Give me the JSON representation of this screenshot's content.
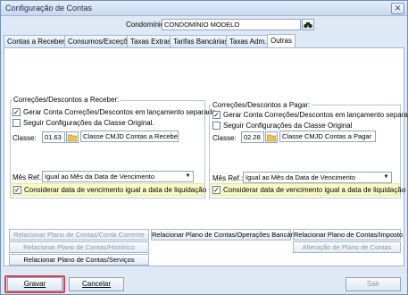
{
  "window": {
    "title": "Configuração de Contas",
    "close": "✕"
  },
  "condominio": {
    "label": "Condomínio:",
    "value": "CONDOMÍNIO MODELO"
  },
  "tabs": [
    {
      "label": "Contas a Receber"
    },
    {
      "label": "Consumos/Exceções"
    },
    {
      "label": "Taxas Extras"
    },
    {
      "label": "Tarifas Bancárias"
    },
    {
      "label": "Taxas Adm."
    },
    {
      "label": "Outras"
    }
  ],
  "receber": {
    "legend": "Correções/Descontos a Receber:",
    "chk_gerar": "Gerar Conta Correções/Descontos em lançamento separado.",
    "chk_seguir": "Seguir Configurações da Classe Original.",
    "classe_label": "Classe:",
    "classe_code": "01.63",
    "classe_desc": "Classe CMJD Contas a Receber",
    "mes_label": "Mês Ref.:",
    "mes_value": "Igual ao Mês da Data de Vencimento",
    "considerar": "Considerar data de vencimento igual a data de liquidação"
  },
  "pagar": {
    "legend": "Correções/Descontos a Pagar:",
    "chk_gerar": "Gerar Conta Correções/Descontos em lançamento separado.",
    "chk_seguir": "Seguir Configurações da Classe Original",
    "classe_label": "Classe:",
    "classe_code": "02.28",
    "classe_desc": "Classe CMJD Contas a Pagar",
    "mes_label": "Mês Ref.:",
    "mes_value": "Igual ao Mês da Data de Vencimento",
    "considerar": "Considerar data de vencimento igual a data de liquidação"
  },
  "buttons": {
    "plano_cc": "Relacionar Plano de Contas/Conta Corrente",
    "plano_ob": "Relacionar Plano de Contas/Operações Bancárias",
    "plano_imp": "Relacionar Plano de Contas/Imposto",
    "plano_hist": "Relacionar Plano de Contas/Histórico",
    "alteracao": "Alteração de Plano de Contas",
    "plano_serv": "Relacionar Plano de Contas/Serviços"
  },
  "footer": {
    "gravar": "Gravar",
    "cancelar": "Cancelar",
    "sair": "Sair"
  }
}
